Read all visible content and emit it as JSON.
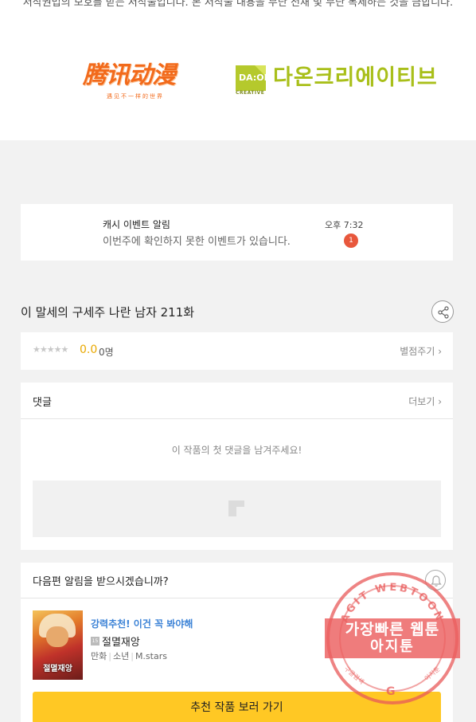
{
  "copyright": "저작권법의 보호를 받는 저작물입니다. 본 저작물 내용을 무단 전재 및 무단 복제하는 것을 금합니다.",
  "logos": {
    "tencent_main": "腾讯动漫",
    "tencent_sub": "遇见不一样的世界",
    "daon_mark": "DA:ON",
    "daon_sub": "CREATIVE",
    "daon_text": "다온크리에이티브"
  },
  "notice": {
    "title": "캐시 이벤트 알림",
    "body": "이번주에 확인하지 못한 이벤트가 있습니다.",
    "time": "오후 7:32",
    "badge": "1"
  },
  "episode": {
    "title": "이 말세의 구세주 나란 남자 211화"
  },
  "rating": {
    "stars": "★★★★★",
    "score": "0.0",
    "voters": "0명",
    "rate_label": "별점주기 ›"
  },
  "comments": {
    "title": "댓글",
    "more_label": "더보기 ›",
    "empty_message": "이 작품의 첫 댓글을 남겨주세요!"
  },
  "subscribe": {
    "question": "다음편 알림을 받으시겠습니까?",
    "thumb_caption": "절멸재앙",
    "promo": "강력추천! 이건 꼭 봐야해",
    "age_badge": "15",
    "work_title": "절멸재앙",
    "genre": "만화",
    "category": "소년",
    "author": "M.stars",
    "separator": "|",
    "cta_label": "추천 작품 보러 가기"
  },
  "watermark": {
    "arc_text": "AGIT WEBTOON",
    "line1": "가장빠른 웹툰",
    "line2": "아지툰",
    "foot_left": "구글검색",
    "foot_right": "아지툰",
    "g_mark": "G"
  },
  "colors": {
    "accent_yellow": "#ffc824",
    "score_yellow": "#e9a800",
    "badge_red": "#e8573c",
    "promo_blue": "#3b82d6",
    "tencent_orange": "#f26a1b",
    "daon_green": "#a9bf1a"
  }
}
